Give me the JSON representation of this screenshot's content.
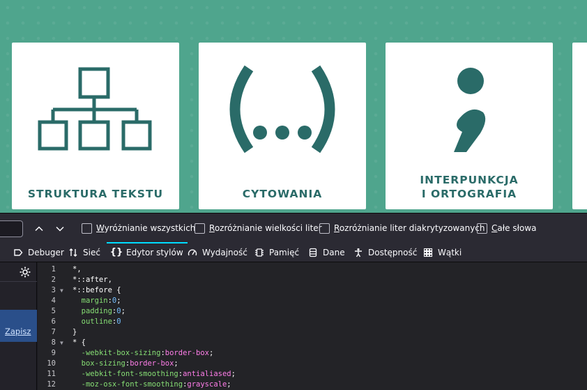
{
  "webpage": {
    "cards": [
      {
        "title_lines": [
          "STRUKTURA TEKSTU"
        ],
        "icon": "hierarchy-icon"
      },
      {
        "title_lines": [
          "CYTOWANIA"
        ],
        "icon": "parentheses-ellipsis-icon"
      },
      {
        "title_lines": [
          "INTERPUNKCJA",
          "I ORTOGRAFIA"
        ],
        "icon": "semicolon-icon"
      }
    ],
    "colors": {
      "background": "#4fa58d",
      "card": "#ffffff",
      "accent": "#2a6b68"
    }
  },
  "findbar": {
    "input_value": "",
    "options": [
      {
        "label_pre": "",
        "label_u": "W",
        "label_post": "yróżnianie wszystkich",
        "checked": false
      },
      {
        "label_pre": "",
        "label_u": "R",
        "label_post": "ozróżnianie wielkości liter",
        "checked": false
      },
      {
        "label_pre": "",
        "label_u": "R",
        "label_post": "ozróżnianie liter diakrytyzowanych",
        "checked": false
      },
      {
        "label_pre": "",
        "label_u": "C",
        "label_post": "ałe słowa",
        "checked": false
      }
    ]
  },
  "devtools": {
    "tabs": [
      {
        "label": "Debuger",
        "icon": "debugger-icon"
      },
      {
        "label": "Sieć",
        "icon": "network-icon"
      },
      {
        "label": "Edytor stylów",
        "icon": "style-editor-icon",
        "selected": true
      },
      {
        "label": "Wydajność",
        "icon": "performance-icon"
      },
      {
        "label": "Pamięć",
        "icon": "memory-icon"
      },
      {
        "label": "Dane",
        "icon": "storage-icon"
      },
      {
        "label": "Dostępność",
        "icon": "accessibility-icon"
      },
      {
        "label": "Wątki",
        "icon": "threads-icon"
      }
    ],
    "sidebar": {
      "save_label": "Zapisz"
    },
    "code_lines": [
      {
        "n": "1",
        "fold": "",
        "tokens": [
          [
            "sel",
            "*,"
          ]
        ]
      },
      {
        "n": "2",
        "fold": "",
        "tokens": [
          [
            "sel",
            "*::after,"
          ]
        ]
      },
      {
        "n": "3",
        "fold": "▼",
        "tokens": [
          [
            "sel",
            "*::before {"
          ]
        ]
      },
      {
        "n": "4",
        "fold": "",
        "tokens": [
          [
            "sp",
            "  "
          ],
          [
            "prop",
            "margin"
          ],
          [
            "punc",
            ":"
          ],
          [
            "num",
            "0"
          ],
          [
            "punc",
            ";"
          ]
        ]
      },
      {
        "n": "5",
        "fold": "",
        "tokens": [
          [
            "sp",
            "  "
          ],
          [
            "prop",
            "padding"
          ],
          [
            "punc",
            ":"
          ],
          [
            "num",
            "0"
          ],
          [
            "punc",
            ";"
          ]
        ]
      },
      {
        "n": "6",
        "fold": "",
        "tokens": [
          [
            "sp",
            "  "
          ],
          [
            "prop",
            "outline"
          ],
          [
            "punc",
            ":"
          ],
          [
            "num",
            "0"
          ]
        ]
      },
      {
        "n": "7",
        "fold": "",
        "tokens": [
          [
            "punc",
            "}"
          ]
        ]
      },
      {
        "n": "8",
        "fold": "▼",
        "tokens": [
          [
            "sel",
            "* {"
          ]
        ]
      },
      {
        "n": "9",
        "fold": "",
        "tokens": [
          [
            "sp",
            "  "
          ],
          [
            "prop",
            "-webkit-box-sizing"
          ],
          [
            "punc",
            ":"
          ],
          [
            "val",
            "border-box"
          ],
          [
            "punc",
            ";"
          ]
        ]
      },
      {
        "n": "10",
        "fold": "",
        "tokens": [
          [
            "sp",
            "  "
          ],
          [
            "prop",
            "box-sizing"
          ],
          [
            "punc",
            ":"
          ],
          [
            "val",
            "border-box"
          ],
          [
            "punc",
            ";"
          ]
        ]
      },
      {
        "n": "11",
        "fold": "",
        "tokens": [
          [
            "sp",
            "  "
          ],
          [
            "prop",
            "-webkit-font-smoothing"
          ],
          [
            "punc",
            ":"
          ],
          [
            "val",
            "antialiased"
          ],
          [
            "punc",
            ";"
          ]
        ]
      },
      {
        "n": "12",
        "fold": "",
        "tokens": [
          [
            "sp",
            "  "
          ],
          [
            "prop",
            "-moz-osx-font-smoothing"
          ],
          [
            "punc",
            ":"
          ],
          [
            "val",
            "grayscale"
          ],
          [
            "punc",
            ";"
          ]
        ]
      }
    ]
  }
}
